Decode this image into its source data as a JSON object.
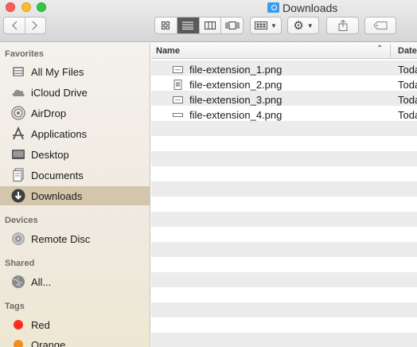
{
  "window": {
    "title": "Downloads"
  },
  "toolbar": {
    "back_icon": "chevron-left-icon",
    "forward_icon": "chevron-right-icon",
    "views": [
      "icon-view",
      "list-view",
      "column-view",
      "cover-flow-view"
    ],
    "active_view": "list-view"
  },
  "sidebar": {
    "sections": [
      {
        "title": "Favorites",
        "items": [
          {
            "label": "All My Files",
            "icon": "all-files-icon"
          },
          {
            "label": "iCloud Drive",
            "icon": "cloud-icon"
          },
          {
            "label": "AirDrop",
            "icon": "airdrop-icon"
          },
          {
            "label": "Applications",
            "icon": "applications-icon"
          },
          {
            "label": "Desktop",
            "icon": "desktop-icon"
          },
          {
            "label": "Documents",
            "icon": "documents-icon"
          },
          {
            "label": "Downloads",
            "icon": "downloads-icon",
            "selected": true
          }
        ]
      },
      {
        "title": "Devices",
        "items": [
          {
            "label": "Remote Disc",
            "icon": "disc-icon"
          }
        ]
      },
      {
        "title": "Shared",
        "items": [
          {
            "label": "All...",
            "icon": "network-icon"
          }
        ]
      },
      {
        "title": "Tags",
        "items": [
          {
            "label": "Red",
            "color": "#ff2d20"
          },
          {
            "label": "Orange",
            "color": "#f68b1f"
          }
        ]
      }
    ]
  },
  "list": {
    "columns": {
      "name": "Name",
      "date": "Date"
    },
    "files": [
      {
        "name": "file-extension_1.png",
        "date": "Today"
      },
      {
        "name": "file-extension_2.png",
        "date": "Today"
      },
      {
        "name": "file-extension_3.png",
        "date": "Today"
      },
      {
        "name": "file-extension_4.png",
        "date": "Today"
      }
    ]
  },
  "colors": {
    "selected": "#d3c6ad",
    "accent": "#3a9bf0"
  }
}
